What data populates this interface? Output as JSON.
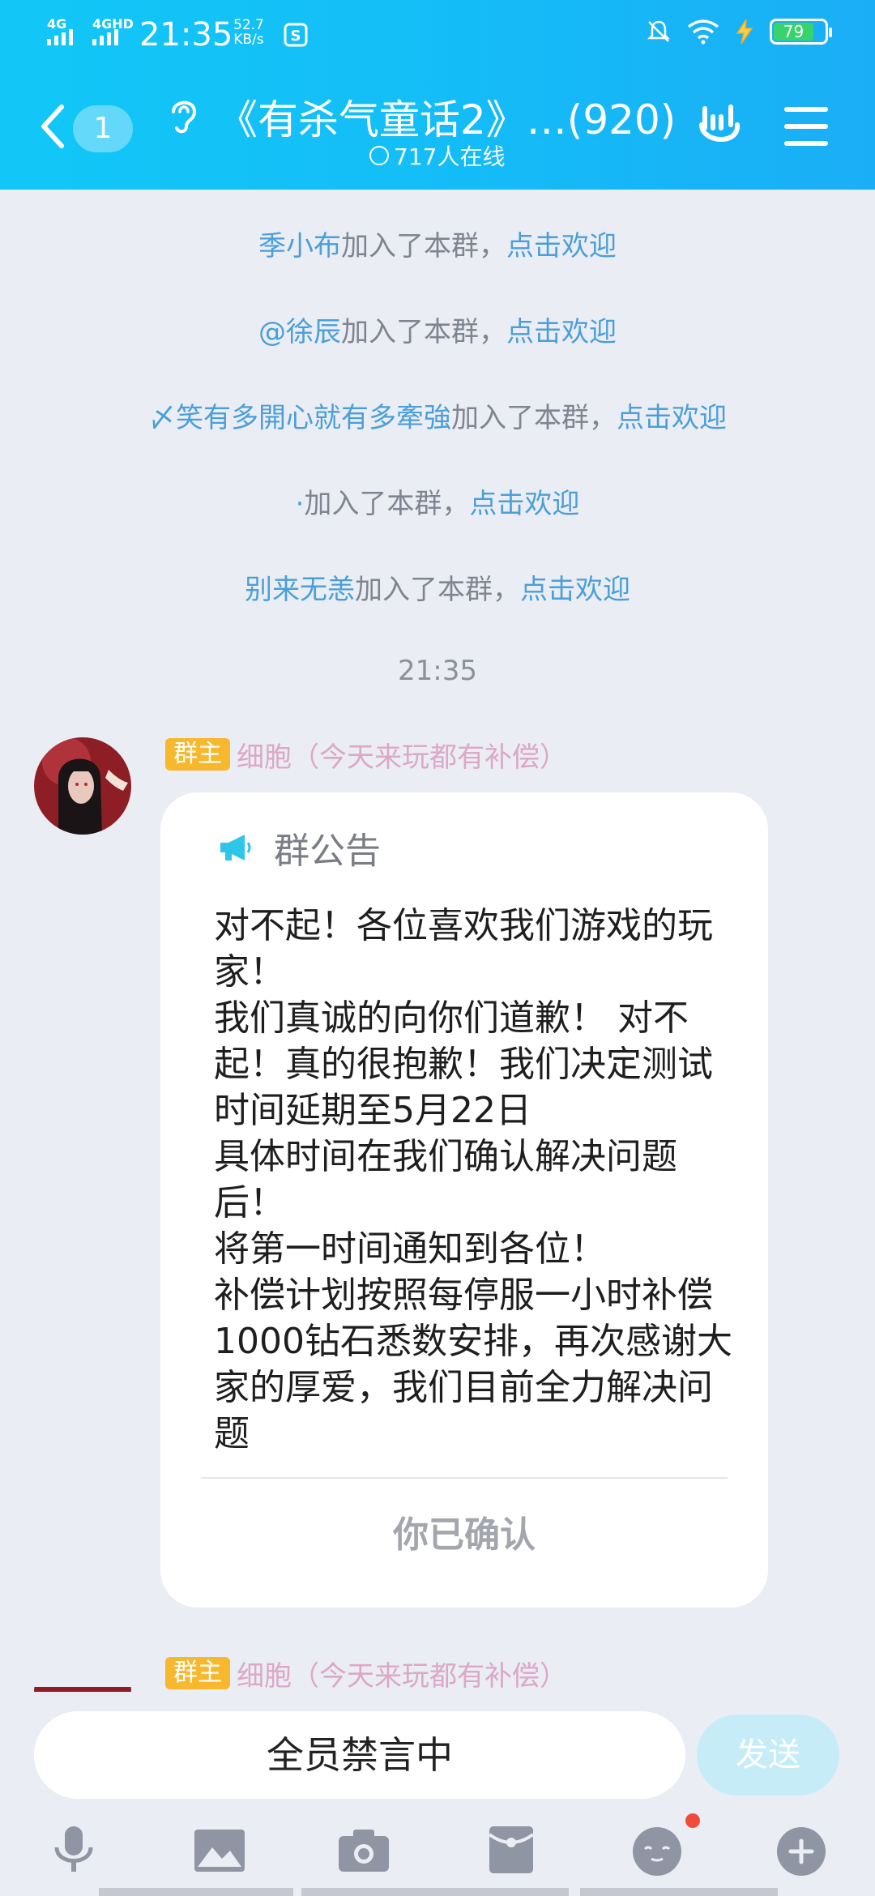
{
  "status_bar": {
    "net1": "4G",
    "net2": "4GHD",
    "time": "21:35",
    "speed_value": "52.7",
    "speed_unit": "KB/s",
    "battery": "79"
  },
  "header": {
    "unread": "1",
    "title": "《有杀气童话2》…(920)",
    "online": "717人在线"
  },
  "system_messages": [
    {
      "name": "季小布",
      "text": "加入了本群，",
      "action": "点击欢迎"
    },
    {
      "name": "@徐辰",
      "text": "加入了本群，",
      "action": "点击欢迎"
    },
    {
      "name": "〆笑有多開心就有多牽強",
      "text": "加入了本群，",
      "action": "点击欢迎"
    },
    {
      "name": "·",
      "text": "加入了本群，",
      "action": "点击欢迎"
    },
    {
      "name": "别来无恙",
      "text": "加入了本群，",
      "action": "点击欢迎"
    }
  ],
  "timestamp": "21:35",
  "message1": {
    "role": "群主",
    "sender": "细胞（今天来玩都有补偿）",
    "notice_title": "群公告",
    "notice_body": "对不起！各位喜欢我们游戏的玩家！\n我们真诚的向你们道歉！ 对不起！真的很抱歉！我们决定测试时间延期至5月22日\n 具体时间在我们确认解决问题后！\n将第一时间通知到各位！\n补偿计划按照每停服一小时补偿1000钻石悉数安排，再次感谢大家的厚爱，我们目前全力解决问题",
    "confirmed": "你已确认"
  },
  "message2": {
    "role": "群主",
    "sender": "细胞（今天来玩都有补偿）"
  },
  "input": {
    "muted_text": "全员禁言中",
    "send_label": "发送"
  },
  "colors": {
    "header_gradient_start": "#12c7f7",
    "header_gradient_end": "#1aaef6",
    "link_blue": "#4a9fd8",
    "role_badge": "#f7b82e",
    "background": "#ebedf4"
  },
  "icons": [
    "back-icon",
    "ear-icon",
    "clock-check-icon",
    "hand-gesture-icon",
    "menu-icon",
    "megaphone-icon",
    "microphone-icon",
    "image-icon",
    "camera-icon",
    "red-packet-icon",
    "emoji-icon",
    "plus-icon"
  ]
}
